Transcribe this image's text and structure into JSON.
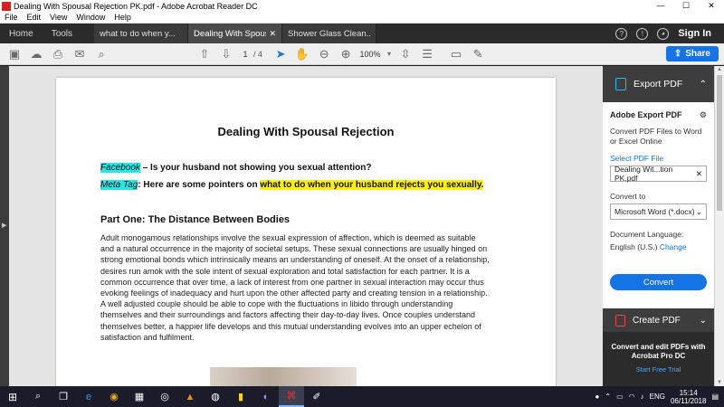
{
  "window": {
    "title": "Dealing With Spousal Rejection PK.pdf - Adobe Acrobat Reader DC",
    "controls": [
      "—",
      "☐",
      "✕"
    ]
  },
  "menu": [
    "File",
    "Edit",
    "View",
    "Window",
    "Help"
  ],
  "tabs": {
    "home": "Home",
    "tools": "Tools",
    "docs": [
      {
        "label": "what to do when y...",
        "active": false
      },
      {
        "label": "Dealing With Spous...",
        "active": true
      },
      {
        "label": "Shower Glass Clean...",
        "active": false
      }
    ],
    "signin": "Sign In"
  },
  "toolbar": {
    "page_current": "1",
    "page_total": "/ 4",
    "zoom": "100%",
    "share": "Share"
  },
  "document": {
    "title": "Dealing With Spousal Rejection",
    "fb_label": "Facebook",
    "fb_text": " – Is your husband not showing you sexual attention?",
    "meta_label": "Meta Tag",
    "meta_text": ": Here are some pointers on ",
    "meta_highlight": "what to do when your husband rejects you sexually.",
    "heading": "Part One: The Distance Between Bodies",
    "paragraph": "Adult monogamous relationships involve the sexual expression of affection, which is deemed as suitable and a natural occurrence in the majority of societal setups. These sexual connections are usually hinged on strong emotional bonds which intrinsically means an understanding of oneself. At the onset of a relationship, desires run amok with the sole intent of sexual exploration and total satisfaction for each partner. It is a common occurrence that over time, a lack of interest from one partner in sexual interaction may occur thus evoking feelings of inadequacy and hurt upon the other affected party and creating tension in a relationship. A well adjusted couple should be able to cope with the fluctuations in libido through understanding themselves and their surroundings and factors affecting their day-to-day lives. Once couples understand themselves better, a happier life develops and this mutual understanding evolves into an upper echelon of satisfaction and fulfilment."
  },
  "panel": {
    "export_header": "Export PDF",
    "body_title": "Adobe Export PDF",
    "desc": "Convert PDF Files to Word or Excel Online",
    "select_label": "Select PDF File",
    "file_name": "Dealing Wit...tion PK.pdf",
    "convert_to_label": "Convert to",
    "format": "Microsoft Word (*.docx)",
    "lang_label": "Document Language:",
    "lang_value": "English (U.S.)",
    "change": "Change",
    "convert_btn": "Convert",
    "create_header": "Create PDF",
    "promo": "Convert and edit PDFs with Acrobat Pro DC",
    "trial": "Start Free Trial"
  },
  "taskbar": {
    "lang": "ENG",
    "time": "15:14",
    "date": "06/11/2018"
  }
}
